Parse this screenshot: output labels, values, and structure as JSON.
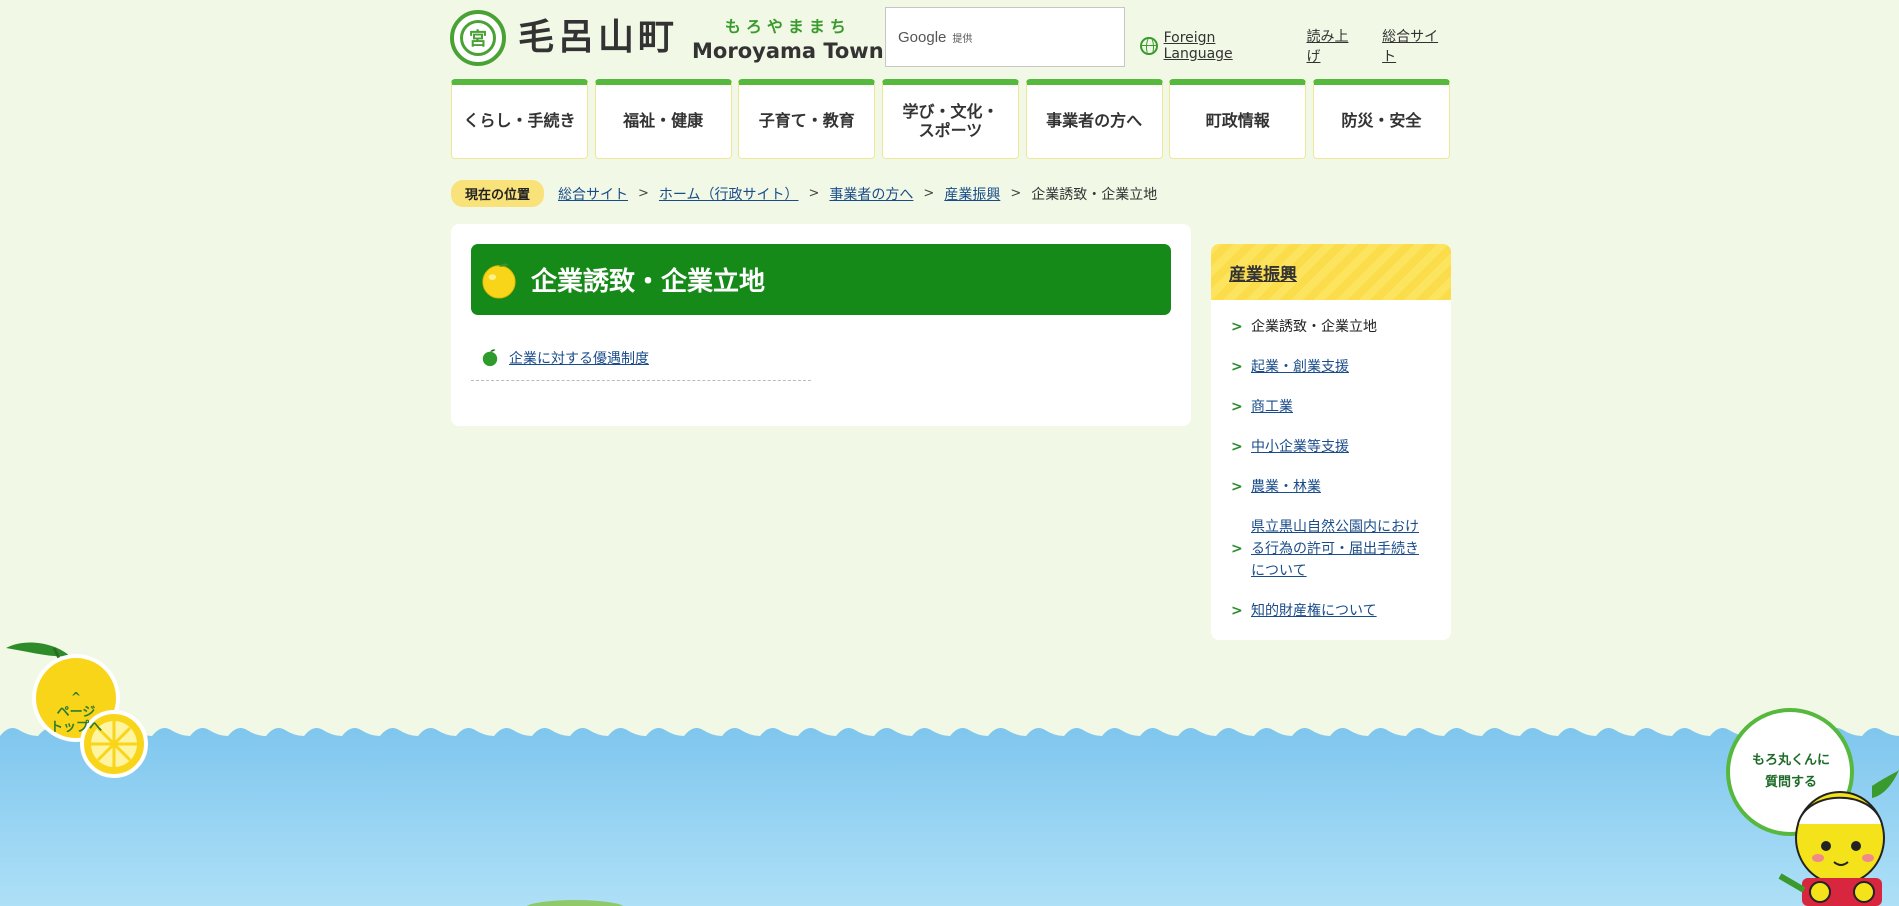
{
  "header": {
    "logo_mark_char": "宮",
    "logo_kanji": "毛呂山町",
    "logo_kana": "もろやままち",
    "logo_en": "Moroyama Town",
    "search_google": "Google",
    "search_provided": "提供",
    "links": {
      "foreign_language": "Foreign Language",
      "read_aloud": "読み上げ",
      "general_site": "総合サイト"
    }
  },
  "gnav": [
    {
      "label": "くらし・手続き"
    },
    {
      "label": "福祉・健康"
    },
    {
      "label": "子育て・教育"
    },
    {
      "label": "学び・文化・スポーツ"
    },
    {
      "label": "事業者の方へ"
    },
    {
      "label": "町政情報"
    },
    {
      "label": "防災・安全"
    }
  ],
  "breadcrumb": {
    "label": "現在の位置",
    "items": [
      "総合サイト",
      "ホーム（行政サイト）",
      "事業者の方へ",
      "産業振興"
    ],
    "separator": ">",
    "current": "企業誘致・企業立地"
  },
  "main": {
    "title": "企業誘致・企業立地",
    "links": [
      "企業に対する優遇制度"
    ]
  },
  "side": {
    "heading": "産業振興",
    "chevron": ">",
    "items": [
      {
        "label": "企業誘致・企業立地",
        "current": true
      },
      {
        "label": "起業・創業支援"
      },
      {
        "label": "商工業"
      },
      {
        "label": "中小企業等支援"
      },
      {
        "label": "農業・林業"
      },
      {
        "label": "県立黒山自然公園内における行為の許可・届出手続きについて"
      },
      {
        "label": "知的財産権について"
      }
    ]
  },
  "pagetop": {
    "arrow": "^",
    "label_line1": "ページ",
    "label_line2": "トップへ"
  },
  "mascot": {
    "label_line1": "もろ丸くんに",
    "label_line2": "質問する"
  },
  "colors": {
    "background": "#f1f9e6",
    "brand_green": "#168a18",
    "nav_top_border": "#57b83e",
    "accent_yellow": "#fde45f",
    "sea_blue": "#8ccdf0"
  }
}
